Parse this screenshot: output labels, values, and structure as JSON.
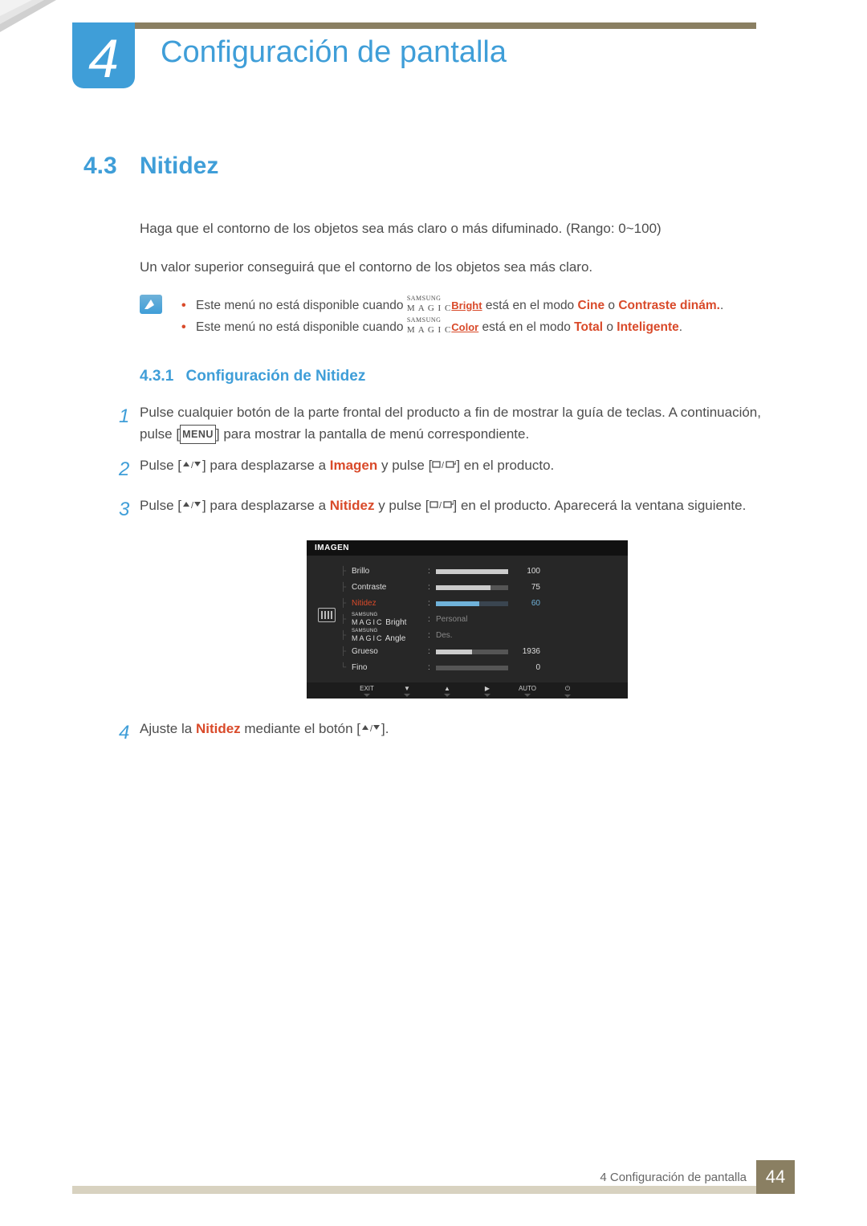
{
  "chapter_number": "4",
  "chapter_title": "Configuración de pantalla",
  "section": {
    "number": "4.3",
    "title": "Nitidez"
  },
  "intro": {
    "p1": "Haga que el contorno de los objetos sea más claro o más difuminado. (Rango: 0~100)",
    "p2": "Un valor superior conseguirá que el contorno de los objetos sea más claro."
  },
  "notes": [
    {
      "pre": "Este menú no está disponible cuando ",
      "magic_label": "Bright",
      "mid": " está en el modo ",
      "opt1": "Cine",
      "or": " o ",
      "opt2": "Contraste dinám.",
      "tail": "."
    },
    {
      "pre": "Este menú no está disponible cuando ",
      "magic_label": "Color",
      "mid": " está en el modo ",
      "opt1": "Total",
      "or": " o ",
      "opt2": "Inteligente",
      "tail": "."
    }
  ],
  "subsection": {
    "number": "4.3.1",
    "title": "Configuración de Nitidez"
  },
  "steps": {
    "s1a": "Pulse cualquier botón de la parte frontal del producto a fin de mostrar la guía de teclas. A continuación, pulse [",
    "s1_menu": "MENU",
    "s1b": "] para mostrar la pantalla de menú correspondiente.",
    "s2a": "Pulse [",
    "s2b": "] para desplazarse a ",
    "s2_target": "Imagen",
    "s2c": " y pulse [",
    "s2d": "] en el producto.",
    "s3a": "Pulse [",
    "s3b": "] para desplazarse a ",
    "s3_target": "Nitidez",
    "s3c": " y pulse [",
    "s3d": "] en el producto. Aparecerá la ventana siguiente.",
    "s4a": "Ajuste la ",
    "s4_target": "Nitidez",
    "s4b": " mediante el botón [",
    "s4c": "]."
  },
  "osd": {
    "title": "IMAGEN",
    "rows": [
      {
        "label": "Brillo",
        "value": "100",
        "fill": 100
      },
      {
        "label": "Contraste",
        "value": "75",
        "fill": 75
      },
      {
        "label": "Nitidez",
        "value": "60",
        "fill": 60,
        "highlight": true
      },
      {
        "label_magic": "Bright",
        "text": "Personal"
      },
      {
        "label_magic": "Angle",
        "text": "Des."
      },
      {
        "label": "Grueso",
        "value": "1936",
        "fill": 50
      },
      {
        "label": "Fino",
        "value": "0",
        "fill": 0
      }
    ],
    "buttons": [
      "EXIT",
      "▼",
      "▲",
      "▶",
      "AUTO",
      "⏻"
    ]
  },
  "footer": {
    "text": "4 Configuración de pantalla",
    "page": "44"
  }
}
